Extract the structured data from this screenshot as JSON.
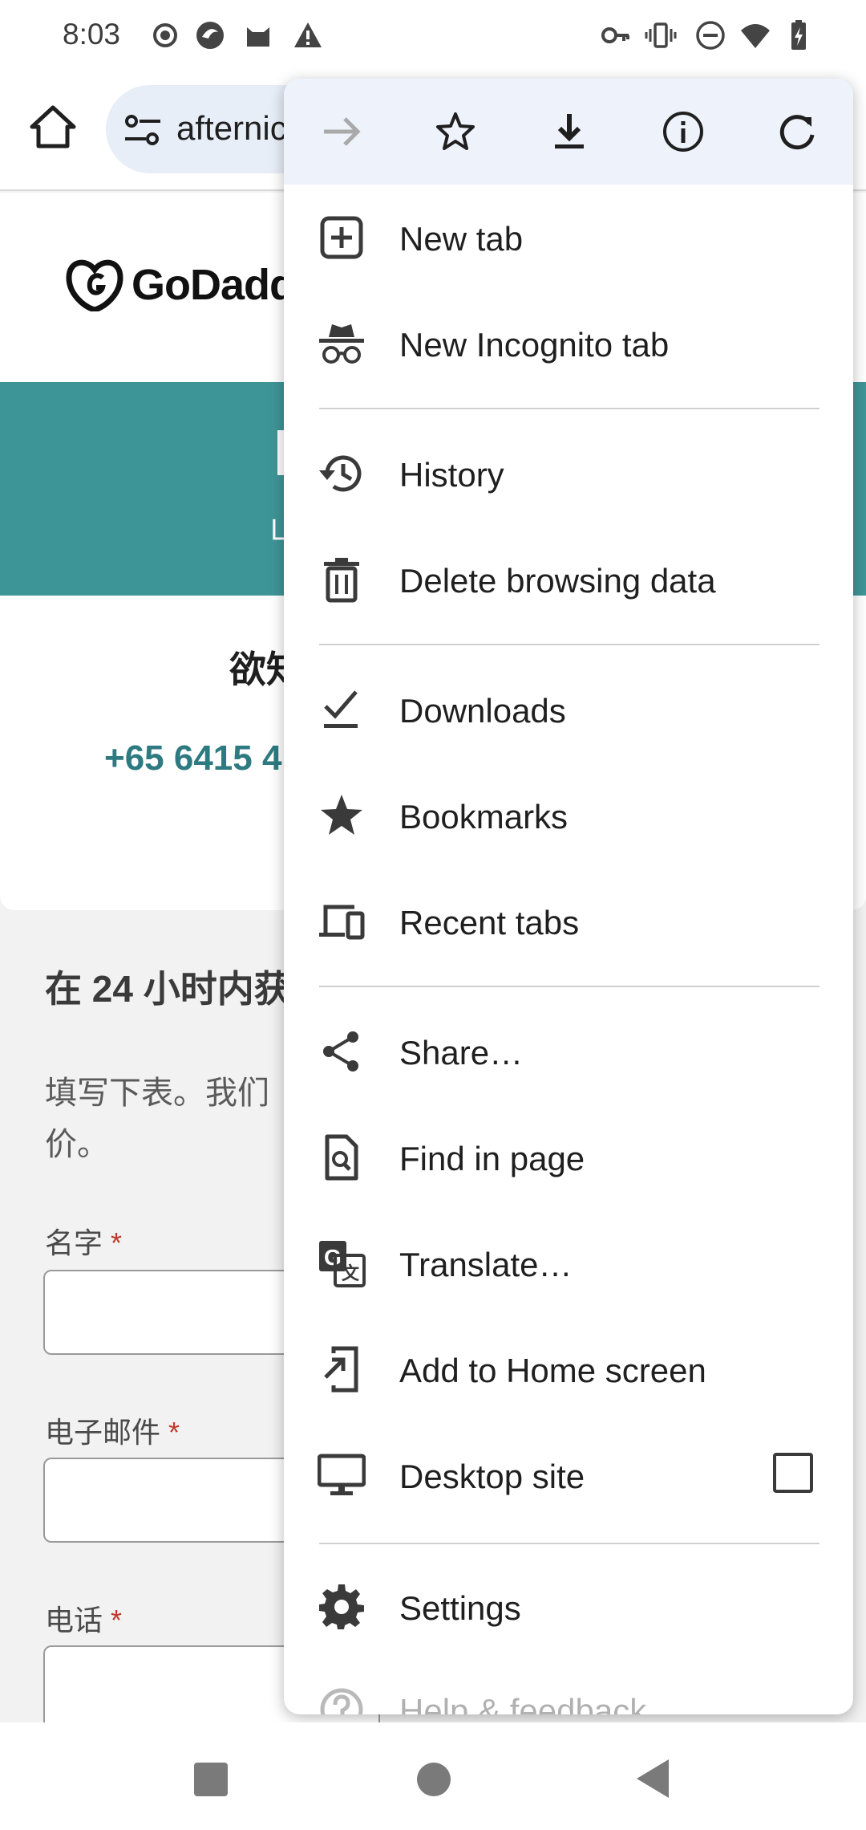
{
  "status_bar": {
    "time": "8:03",
    "left_icons": [
      "record-icon",
      "app-icon",
      "cat-icon",
      "warning-icon"
    ],
    "right_icons": [
      "key-icon",
      "vibrate-icon",
      "dnd-icon",
      "wifi-icon",
      "battery-icon"
    ]
  },
  "toolbar": {
    "url": "afternic",
    "home_icon": "home-icon",
    "tune_icon": "tune-icon"
  },
  "page": {
    "logo_text": "GoDadd",
    "hero_subtext": "山",
    "card_title": "欲知",
    "card_phone": "+65 6415 4",
    "form_title": "在 24 小时内获",
    "form_desc": "填写下表。我们价。",
    "fields": [
      {
        "label": "名字",
        "required": "*"
      },
      {
        "label": "电子邮件",
        "required": "*"
      },
      {
        "label": "电话",
        "required": "*"
      }
    ]
  },
  "menu": {
    "top_actions": [
      {
        "name": "forward-icon",
        "enabled": false
      },
      {
        "name": "bookmark-star-icon",
        "enabled": true
      },
      {
        "name": "download-icon",
        "enabled": true
      },
      {
        "name": "info-icon",
        "enabled": true
      },
      {
        "name": "reload-icon",
        "enabled": true
      }
    ],
    "items": [
      {
        "label": "New tab",
        "icon": "new-tab-icon"
      },
      {
        "label": "New Incognito tab",
        "icon": "incognito-icon"
      },
      {
        "label": "History",
        "icon": "history-icon"
      },
      {
        "label": "Delete browsing data",
        "icon": "trash-icon"
      },
      {
        "label": "Downloads",
        "icon": "downloads-check-icon"
      },
      {
        "label": "Bookmarks",
        "icon": "star-icon"
      },
      {
        "label": "Recent tabs",
        "icon": "devices-icon"
      },
      {
        "label": "Share…",
        "icon": "share-icon"
      },
      {
        "label": "Find in page",
        "icon": "find-in-page-icon"
      },
      {
        "label": "Translate…",
        "icon": "translate-icon"
      },
      {
        "label": "Add to Home screen",
        "icon": "add-to-home-icon"
      },
      {
        "label": "Desktop site",
        "icon": "desktop-icon",
        "checkbox": false
      },
      {
        "label": "Settings",
        "icon": "gear-icon"
      },
      {
        "label": "Help & feedback",
        "icon": "help-icon"
      }
    ]
  },
  "nav_bar": {
    "icons": [
      "recents-square-icon",
      "home-circle-icon",
      "back-triangle-icon"
    ]
  }
}
